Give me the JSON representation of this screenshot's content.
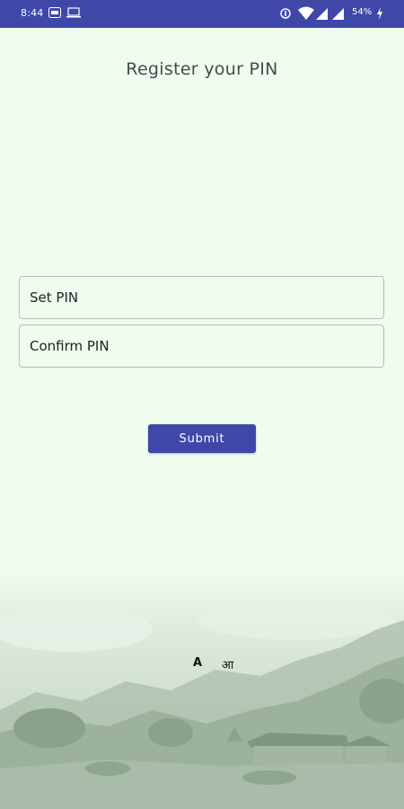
{
  "status_bar": {
    "time": "8:44",
    "battery_text": "54%",
    "icons": [
      "notification-icon",
      "laptop-icon",
      "alarm-icon",
      "wifi-icon",
      "signal-icon",
      "signal-icon",
      "battery-charging-icon"
    ]
  },
  "page": {
    "title": "Register your PIN"
  },
  "form": {
    "set_pin_placeholder": "Set PIN",
    "confirm_pin_placeholder": "Confirm PIN",
    "submit_label": "Submit"
  },
  "language": {
    "english_label": "A",
    "hindi_label": "आ"
  },
  "colors": {
    "accent": "#3f48a8",
    "background": "#eefded",
    "landscape_tint": "#b7c9b7"
  }
}
